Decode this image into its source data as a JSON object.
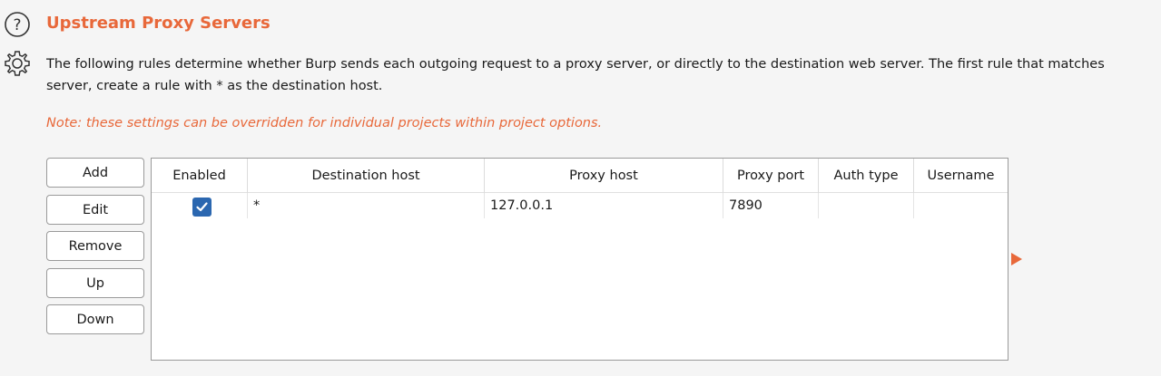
{
  "header": {
    "title": "Upstream Proxy Servers",
    "description_line1": "The following rules determine whether Burp sends each outgoing request to a proxy server, or directly to the destination web server. The first rule that matches",
    "description_line2": "server, create a rule with * as the destination host.",
    "note": "Note: these settings can be overridden for individual projects within project options."
  },
  "buttons": {
    "add": "Add",
    "edit": "Edit",
    "remove": "Remove",
    "up": "Up",
    "down": "Down"
  },
  "table": {
    "columns": [
      "Enabled",
      "Destination host",
      "Proxy host",
      "Proxy port",
      "Auth type",
      "Username"
    ],
    "rows": [
      {
        "enabled": true,
        "destination_host": "*",
        "proxy_host": "127.0.0.1",
        "proxy_port": "7890",
        "auth_type": "",
        "username": ""
      }
    ]
  },
  "colors": {
    "accent": "#e8683a",
    "checkbox": "#2b67b0"
  },
  "icons": [
    "help-icon",
    "gear-icon",
    "checkmark-icon",
    "expand-arrow-icon"
  ]
}
